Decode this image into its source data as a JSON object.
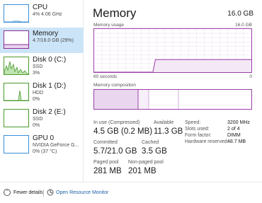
{
  "sidebar": {
    "items": [
      {
        "title": "CPU",
        "sub1": "4% 4.06 GHz",
        "sub2": "",
        "sub3": "",
        "selected": false,
        "color": "#3a8fd6",
        "icon": "cpu-graph-icon"
      },
      {
        "title": "Memory",
        "sub1": "4.7/16.0 GB (29%)",
        "sub2": "",
        "sub3": "",
        "selected": true,
        "color": "#8a2e99",
        "icon": "memory-graph-icon"
      },
      {
        "title": "Disk 0 (C:)",
        "sub1": "SSD",
        "sub2": "3%",
        "sub3": "",
        "selected": false,
        "color": "#4a9a2c",
        "icon": "disk-graph-icon"
      },
      {
        "title": "Disk 1 (D:)",
        "sub1": "HDD",
        "sub2": "0%",
        "sub3": "",
        "selected": false,
        "color": "#4a9a2c",
        "icon": "disk-graph-icon"
      },
      {
        "title": "Disk 2 (E:)",
        "sub1": "SSD",
        "sub2": "0%",
        "sub3": "",
        "selected": false,
        "color": "#4a9a2c",
        "icon": "disk-graph-icon"
      },
      {
        "title": "GPU 0",
        "sub1": "NVIDIA GeForce G...",
        "sub2": "0% (37 °C)",
        "sub3": "",
        "selected": false,
        "color": "#3a8fd6",
        "icon": "gpu-graph-icon"
      }
    ]
  },
  "main": {
    "title": "Memory",
    "total": "16.0 GB",
    "usage_label": "Memory usage",
    "usage_max": "16.0 GB",
    "time_label": "60 seconds",
    "zero_label": "0",
    "composition_label": "Memory composition",
    "usage_fraction_history": [
      0,
      0,
      0,
      0,
      0,
      0,
      0,
      0,
      0,
      0,
      0,
      0,
      0,
      0,
      0,
      0,
      0,
      0,
      0,
      0,
      0,
      0,
      0,
      0.29,
      0.29,
      0.29,
      0.29,
      0.29,
      0.29,
      0.29,
      0.29,
      0.29,
      0.29,
      0.29,
      0.29,
      0.29,
      0.29,
      0.29,
      0.29,
      0.29,
      0.29,
      0.29,
      0.29,
      0.29,
      0.29,
      0.29,
      0.29,
      0.29,
      0.29,
      0.29,
      0.29,
      0.29,
      0.29,
      0.29,
      0.29,
      0.29,
      0.29,
      0.29,
      0.29,
      0.29
    ],
    "accent": "#9a3fa8"
  },
  "stats": {
    "in_use_label": "In use (Compressed)",
    "in_use_value": "4.5 GB (0.2 MB)",
    "available_label": "Available",
    "available_value": "11.3 GB",
    "committed_label": "Committed",
    "committed_value": "5.7/21.0 GB",
    "cached_label": "Cached",
    "cached_value": "3.5 GB",
    "paged_label": "Paged pool",
    "paged_value": "281 MB",
    "nonpaged_label": "Non-paged pool",
    "nonpaged_value": "201 MB"
  },
  "details": {
    "speed_label": "Speed:",
    "speed_value": "3200 MHz",
    "slots_label": "Slots used:",
    "slots_value": "2 of 4",
    "form_label": "Form factor:",
    "form_value": "DIMM",
    "hwres_label": "Hardware reserved:",
    "hwres_value": "48.7 MB"
  },
  "footer": {
    "fewer_details": "Fewer details",
    "open_resource_monitor": "Open Resource Monitor"
  }
}
